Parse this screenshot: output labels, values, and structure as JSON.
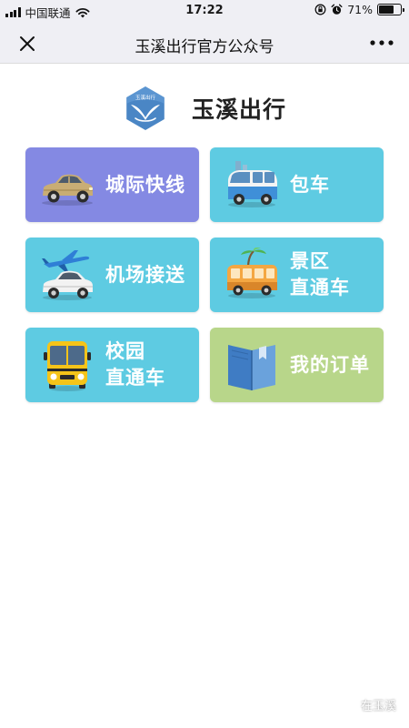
{
  "status_bar": {
    "carrier": "中国联通",
    "time": "17:22",
    "battery": "71%",
    "battery_level": 0.71
  },
  "nav": {
    "title": "玉溪出行官方公众号",
    "close_icon": "close-icon",
    "more_icon": "more-dots-icon"
  },
  "brand": {
    "name": "玉溪出行",
    "logo_text": "玉溪出行",
    "logo_color": "#4a86c5"
  },
  "tiles": [
    {
      "line1": "城际快线",
      "line2": "",
      "icon": "sedan-car-icon",
      "color": "#8489e3"
    },
    {
      "line1": "包车",
      "line2": "",
      "icon": "van-icon",
      "color": "#5ecbe2"
    },
    {
      "line1": "机场接送",
      "line2": "",
      "icon": "airplane-car-icon",
      "color": "#5ecbe2"
    },
    {
      "line1": "景区",
      "line2": "直通车",
      "icon": "tour-bus-icon",
      "color": "#5ecbe2"
    },
    {
      "line1": "校园",
      "line2": "直通车",
      "icon": "school-bus-icon",
      "color": "#5ecbe2"
    },
    {
      "line1": "我的订单",
      "line2": "",
      "icon": "orders-book-icon",
      "color": "#b8d68a"
    }
  ],
  "watermark": {
    "text": "在玉溪",
    "icon": "wechat-logo-icon"
  }
}
